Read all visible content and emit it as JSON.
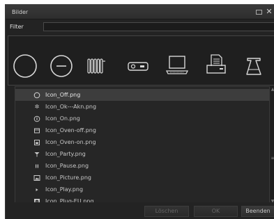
{
  "window": {
    "title": "Bilder"
  },
  "filter": {
    "label": "Filter",
    "value": "",
    "placeholder": ""
  },
  "icon_strip": {
    "icons": [
      "circle-off-icon",
      "circle-minus-icon",
      "radiator-icon",
      "projector-icon",
      "laptop-icon",
      "printer-icon",
      "coffee-pot-icon"
    ]
  },
  "file_list": {
    "selected_index": 0,
    "items": [
      {
        "icon": "circle-off-icon",
        "name": "Icon_Off.png"
      },
      {
        "icon": "ok-ack-icon",
        "name": "Icon_Ok---Akn.png"
      },
      {
        "icon": "power-on-icon",
        "name": "Icon_On.png"
      },
      {
        "icon": "oven-off-icon",
        "name": "Icon_Oven-off.png"
      },
      {
        "icon": "oven-on-icon",
        "name": "Icon_Oven-on.png"
      },
      {
        "icon": "party-icon",
        "name": "Icon_Party.png"
      },
      {
        "icon": "pause-icon",
        "name": "Icon_Pause.png"
      },
      {
        "icon": "picture-icon",
        "name": "Icon_Picture.png"
      },
      {
        "icon": "play-icon",
        "name": "Icon_Play.png"
      },
      {
        "icon": "plug-eu-icon",
        "name": "Icon_Plug-EU.png"
      }
    ]
  },
  "buttons": {
    "delete": "Löschen",
    "ok": "OK",
    "quit": "Beenden"
  }
}
